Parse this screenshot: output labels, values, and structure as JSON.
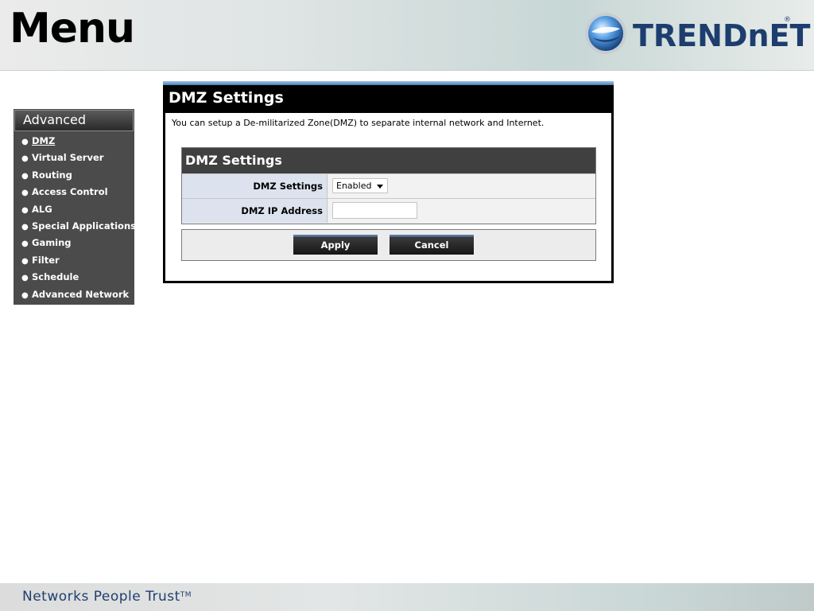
{
  "header": {
    "title": "Menu",
    "logo_text": "TRENDnET",
    "logo_mark": "®"
  },
  "sidebar": {
    "title": "Advanced",
    "items": [
      {
        "label": "DMZ",
        "active": true
      },
      {
        "label": "Virtual Server",
        "active": false
      },
      {
        "label": "Routing",
        "active": false
      },
      {
        "label": "Access Control",
        "active": false
      },
      {
        "label": "ALG",
        "active": false
      },
      {
        "label": "Special Applications",
        "active": false
      },
      {
        "label": "Gaming",
        "active": false
      },
      {
        "label": "Filter",
        "active": false
      },
      {
        "label": "Schedule",
        "active": false
      },
      {
        "label": "Advanced Network",
        "active": false
      }
    ]
  },
  "panel": {
    "title": "DMZ Settings",
    "description": "You can setup a De-militarized Zone(DMZ) to separate internal network and Internet.",
    "section_title": "DMZ Settings",
    "fields": {
      "dmz_settings_label": "DMZ Settings",
      "dmz_settings_value": "Enabled",
      "dmz_ip_label": "DMZ IP Address",
      "dmz_ip_value": ""
    },
    "buttons": {
      "apply": "Apply",
      "cancel": "Cancel"
    }
  },
  "footer": {
    "tagline": "Networks People Trust",
    "tm": "TM"
  },
  "colors": {
    "brand_blue": "#1c3d6e",
    "panel_accent": "#4d7fb3",
    "sidebar_bg": "#4b4b4b"
  }
}
